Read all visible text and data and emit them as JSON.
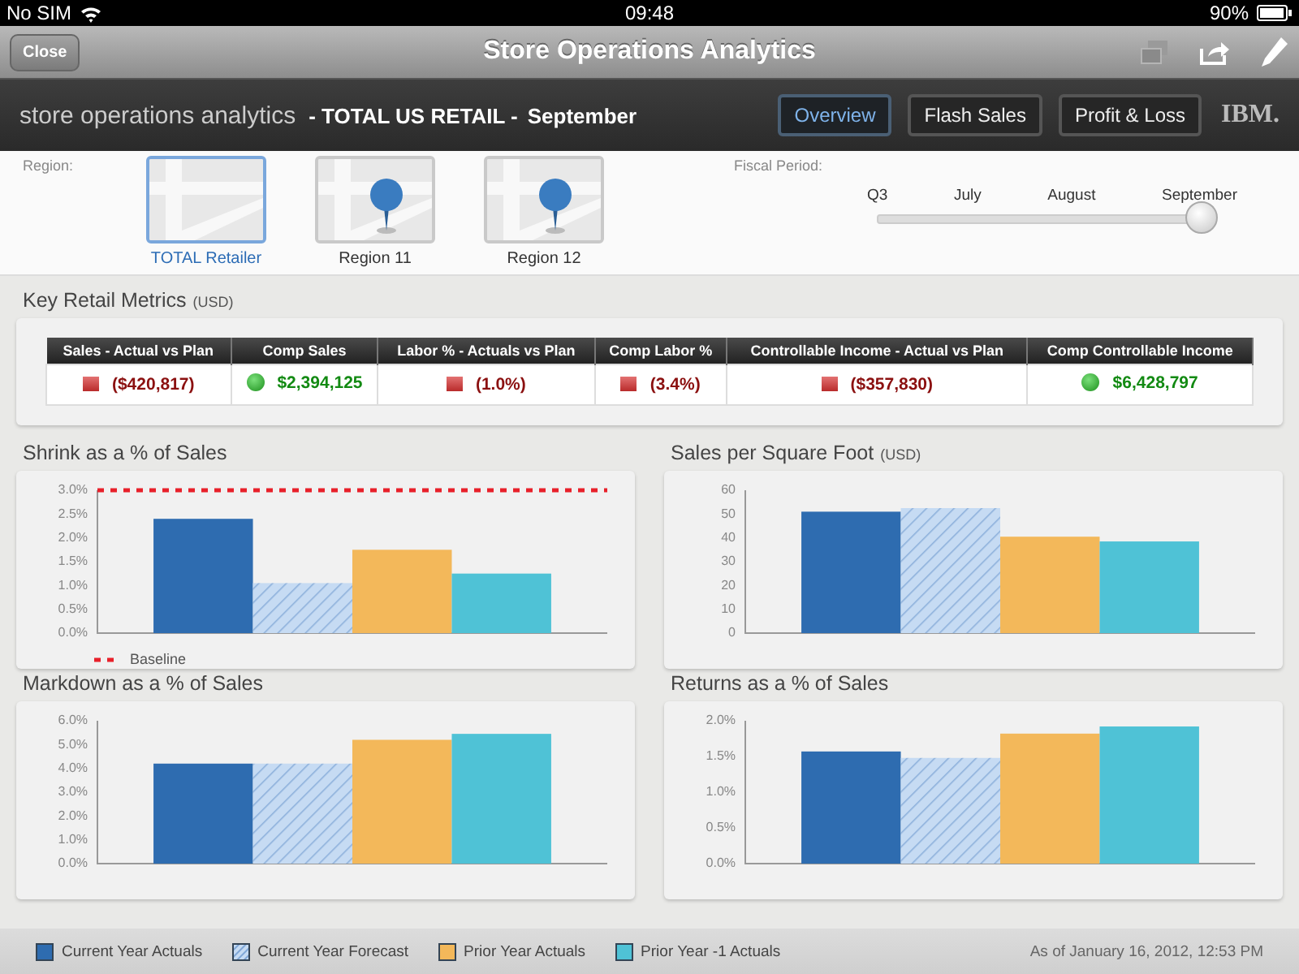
{
  "status_bar": {
    "carrier": "No SIM",
    "time": "09:48",
    "battery": "90%"
  },
  "nav_bar": {
    "close": "Close",
    "title": "Store Operations Analytics"
  },
  "header": {
    "app_name": "store operations analytics",
    "scope": "- TOTAL US RETAIL -",
    "period": "September",
    "logo": "IBM.",
    "tabs": [
      {
        "label": "Overview",
        "selected": true
      },
      {
        "label": "Flash Sales",
        "selected": false
      },
      {
        "label": "Profit & Loss",
        "selected": false
      }
    ]
  },
  "region": {
    "label": "Region:",
    "items": [
      {
        "label": "TOTAL Retailer",
        "kind": "all",
        "selected": true
      },
      {
        "label": "Region 11",
        "kind": "pin",
        "selected": false
      },
      {
        "label": "Region 12",
        "kind": "pin",
        "selected": false
      }
    ]
  },
  "fiscal_period": {
    "label": "Fiscal Period:",
    "stops": [
      "Q3",
      "July",
      "August",
      "September"
    ],
    "level": 1
  },
  "key_metrics": {
    "title": "Key Retail Metrics",
    "unit": "(USD)",
    "columns": [
      {
        "header": "Sales - Actual vs Plan",
        "value": "($420,817)",
        "kind": "negative"
      },
      {
        "header": "Comp Sales",
        "value": "$2,394,125",
        "kind": "positive"
      },
      {
        "header": "Labor % - Actuals vs Plan",
        "value": "(1.0%)",
        "kind": "negative"
      },
      {
        "header": "Comp Labor %",
        "value": "(3.4%)",
        "kind": "negative"
      },
      {
        "header": "Controllable Income - Actual vs Plan",
        "value": "($357,830)",
        "kind": "negative"
      },
      {
        "header": "Comp Controllable Income",
        "value": "$6,428,797",
        "kind": "positive"
      }
    ]
  },
  "charts": [
    {
      "title": "Shrink as a % of Sales",
      "chart_data": {
        "type": "bar",
        "ylim": [
          0,
          3
        ],
        "yticks": [
          {
            "value": 0,
            "label": "0.0%"
          },
          {
            "value": 0.5,
            "label": "0.5%"
          },
          {
            "value": 1,
            "label": "1.0%"
          },
          {
            "value": 1.5,
            "label": "1.5%"
          },
          {
            "value": 2,
            "label": "2.0%"
          },
          {
            "value": 2.5,
            "label": "2.5%"
          },
          {
            "value": 3,
            "label": "3.0%"
          }
        ],
        "series": [
          {
            "color": "#2e6cb0",
            "values": [
              2.4
            ]
          },
          {
            "color": "#c6dbf3",
            "values": [
              1.05
            ]
          },
          {
            "color": "#f3b85a",
            "values": [
              1.75
            ]
          },
          {
            "color": "#4fc2d6",
            "values": [
              1.25
            ]
          }
        ]
      },
      "baseline": {
        "label": "Baseline",
        "color": "#e8202a"
      }
    },
    {
      "title": "Sales per Square Foot",
      "unit": "(USD)",
      "chart_data": {
        "type": "bar",
        "ylim": [
          0,
          60
        ],
        "yticks": [
          0,
          10,
          20,
          30,
          40,
          50,
          60
        ],
        "series": [
          {
            "color": "#2e6cb0",
            "values": [
              51
            ]
          },
          {
            "color": "#c6dbf3",
            "values": [
              52.5
            ]
          },
          {
            "color": "#f3b85a",
            "values": [
              40.5
            ]
          },
          {
            "color": "#4fc2d6",
            "values": [
              38.5
            ]
          }
        ]
      }
    },
    {
      "title": "Markdown as a % of Sales",
      "chart_data": {
        "type": "bar",
        "ylim": [
          0,
          6
        ],
        "yticks": [
          {
            "value": 0,
            "label": "0.0%"
          },
          {
            "value": 1,
            "label": "1.0%"
          },
          {
            "value": 2,
            "label": "2.0%"
          },
          {
            "value": 3,
            "label": "3.0%"
          },
          {
            "value": 4,
            "label": "4.0%"
          },
          {
            "value": 5,
            "label": "5.0%"
          },
          {
            "value": 6,
            "label": "6.0%"
          }
        ],
        "series": [
          {
            "color": "#2e6cb0",
            "values": [
              4.2
            ]
          },
          {
            "color": "#c6dbf3",
            "values": [
              4.2
            ]
          },
          {
            "color": "#f3b85a",
            "values": [
              5.2
            ]
          },
          {
            "color": "#4fc2d6",
            "values": [
              5.45
            ]
          }
        ]
      }
    },
    {
      "title": "Returns as a % of Sales",
      "chart_data": {
        "type": "bar",
        "ylim": [
          0,
          2
        ],
        "yticks": [
          {
            "value": 0,
            "label": "0.0%"
          },
          {
            "value": 0.5,
            "label": "0.5%"
          },
          {
            "value": 1,
            "label": "1.0%"
          },
          {
            "value": 1.5,
            "label": "1.5%"
          },
          {
            "value": 2,
            "label": "2.0%"
          }
        ],
        "series": [
          {
            "color": "#2e6cb0",
            "values": [
              1.57
            ]
          },
          {
            "color": "#c6dbf3",
            "values": [
              1.48
            ]
          },
          {
            "color": "#f3b85a",
            "values": [
              1.82
            ]
          },
          {
            "color": "#4fc2d6",
            "values": [
              1.92
            ]
          }
        ]
      }
    }
  ],
  "legend": [
    {
      "label": "Current Year Actuals",
      "color": "#2e6cb0",
      "kind": "solid"
    },
    {
      "label": "Current Year Forecast",
      "color": "#c6dbf3",
      "kind": "hatched"
    },
    {
      "label": "Prior Year Actuals",
      "color": "#f3b85a",
      "kind": "solid"
    },
    {
      "label": "Prior Year -1 Actuals",
      "color": "#4fc2d6",
      "kind": "solid"
    }
  ],
  "as_of": "As of January 16, 2012, 12:53 PM"
}
